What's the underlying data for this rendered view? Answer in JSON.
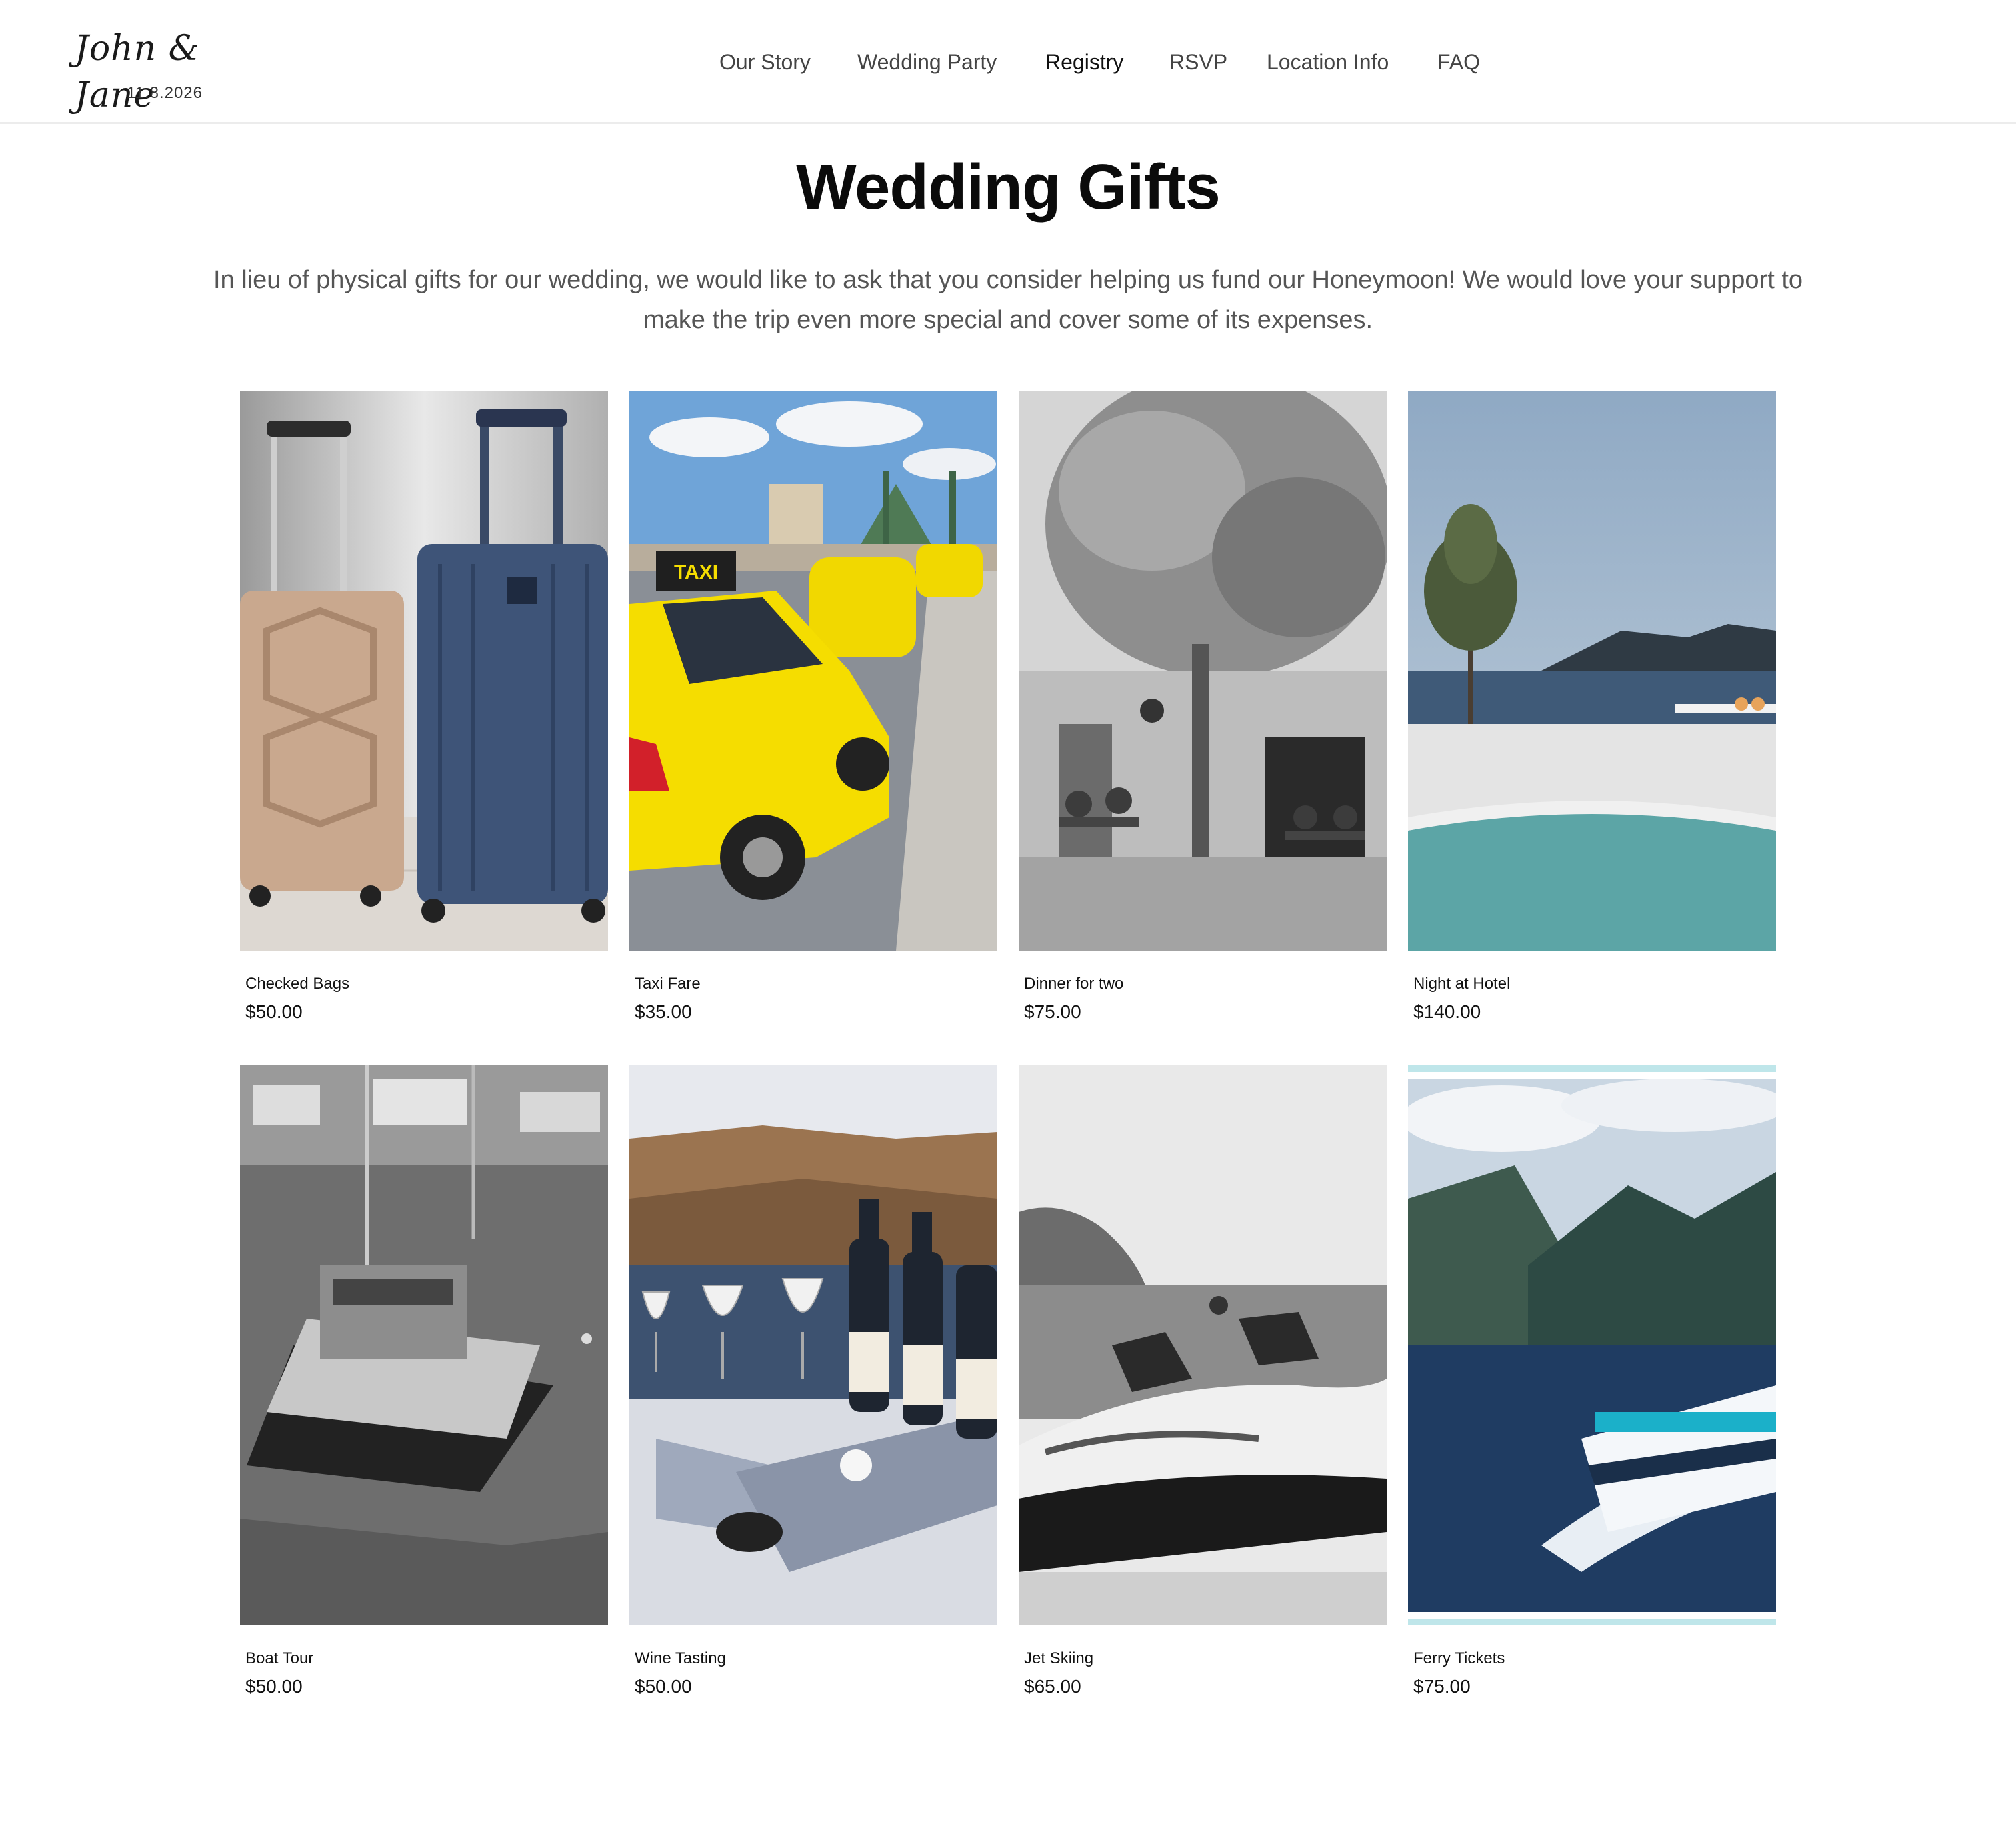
{
  "header": {
    "logo_script": "John & Jane",
    "logo_date": "11.8.2026",
    "nav": [
      "Our Story",
      "Wedding Party",
      "Registry",
      "RSVP",
      "Location Info",
      "FAQ"
    ]
  },
  "page": {
    "title": "Wedding Gifts",
    "intro": "In lieu of physical gifts for our wedding, we would like to ask that you consider helping us fund our Honeymoon! We would love your support to make the trip even more special and cover some of its expenses."
  },
  "gifts": [
    {
      "name": "Checked Bags",
      "price": "$50.00"
    },
    {
      "name": "Taxi Fare",
      "price": "$35.00"
    },
    {
      "name": "Dinner for two",
      "price": "$75.00"
    },
    {
      "name": "Night at Hotel",
      "price": "$140.00"
    },
    {
      "name": "Boat Tour",
      "price": "$50.00"
    },
    {
      "name": "Wine Tasting",
      "price": "$50.00"
    },
    {
      "name": "Jet Skiing",
      "price": "$65.00"
    },
    {
      "name": "Ferry Tickets",
      "price": "$75.00"
    }
  ]
}
